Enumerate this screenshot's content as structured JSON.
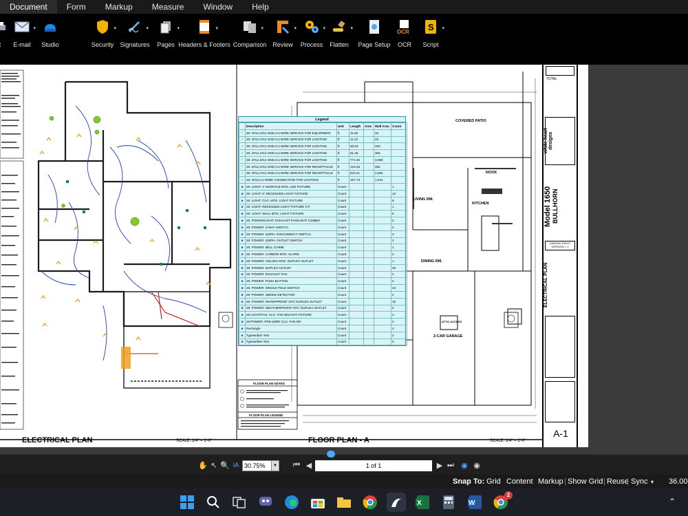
{
  "menu": [
    "Document",
    "Form",
    "Markup",
    "Measure",
    "Window",
    "Help"
  ],
  "ribbon": {
    "buttons": [
      {
        "label": "t",
        "icon": "print-icon"
      },
      {
        "label": "E-mail",
        "icon": "email-icon"
      },
      {
        "label": "Studio",
        "icon": "studio-icon"
      },
      {
        "label": "Security",
        "icon": "security-icon"
      },
      {
        "label": "Signatures",
        "icon": "signatures-icon"
      },
      {
        "label": "Pages",
        "icon": "pages-icon"
      },
      {
        "label": "Headers & Footers",
        "icon": "headers-footers-icon"
      },
      {
        "label": "Comparison",
        "icon": "comparison-icon"
      },
      {
        "label": "Review",
        "icon": "review-icon"
      },
      {
        "label": "Process",
        "icon": "process-icon"
      },
      {
        "label": "Flatten",
        "icon": "flatten-icon"
      },
      {
        "label": "Page Setup",
        "icon": "page-setup-icon"
      },
      {
        "label": "OCR",
        "icon": "ocr-icon"
      },
      {
        "label": "Script",
        "icon": "script-icon"
      }
    ]
  },
  "drawing": {
    "electrical_title": "ELECTRICAL PLAN",
    "floor_title": "FLOOR PLAN - A",
    "scale_text": "SCALE:  1/4\" = 1'-0\"",
    "floor_plan_notes_title": "FLOOR PLAN NOTES",
    "floor_plan_legend_title": "FLOOR PLAN LEGEND",
    "room_labels": [
      "COVERED PATIO",
      "LIVING RM.",
      "KITCHEN",
      "NOOK",
      "DINING RM.",
      "2-CAR GARAGE",
      "ATTIC ACCESS"
    ],
    "title_block": {
      "total": "TOTAL",
      "model": "Model 1650",
      "brand": "BULLHORN",
      "company": "white heart designs",
      "option": "GARAGE RIGHT VERSION = 1",
      "sheet_desc": "ELECTRICAL PLAN",
      "sheet_id": "A-1"
    }
  },
  "legend": {
    "title": "Legend",
    "headers": [
      "",
      "Description",
      "Unit",
      "Length",
      "Area",
      "Wall Area",
      "Count"
    ],
    "rows": [
      [
        "✓",
        "26: 2#12,1#12 GND.CU WIRE SERVICE FOR EQUIPMENT",
        "ft",
        "11.65",
        "",
        "46",
        ""
      ],
      [
        "✓",
        "26: 2#12,1#12 GND.CU WIRE SERVICE FOR LIGHTING",
        "ft",
        "11.22",
        "",
        "45",
        ""
      ],
      [
        "✓",
        "26: 2#12,1#12 GND.CU WIRE SERVICE FOR LIGHTING",
        "ft",
        "50.04",
        "",
        "200",
        ""
      ],
      [
        "✓",
        "26: 2#12,1#12 GND.CU WIRE SERVICE FOR LIGHTING",
        "ft",
        "91.26",
        "",
        "365",
        ""
      ],
      [
        "✓",
        "26: 2#12,1#12 GND.CU WIRE SERVICE FOR LIGHTING",
        "ft",
        "771.94",
        "",
        "3,088",
        ""
      ],
      [
        "✓",
        "26: 2#12,1#12 GND.CU WIRE SERVICE FOR RECEPTACLE",
        "ft",
        "120.53",
        "",
        "482",
        ""
      ],
      [
        "✓",
        "26: 2#12,1#12 GND.CU WIRE SERVICE FOR RECEPTACLE",
        "ft",
        "523.41",
        "",
        "2,094",
        ""
      ],
      [
        "✓",
        "26: 2#12,CU WIRE CONNECTION FOR LIGHTING",
        "ft",
        "257.73",
        "",
        "1,031",
        ""
      ],
      [
        "■",
        "26: LIGHT: 4' SURFACE MTD. LED FIXTURE",
        "Count",
        "",
        "",
        "",
        "1"
      ],
      [
        "■",
        "26: LIGHT: 6\" RECESSED LIGHT FIXTURE",
        "Count",
        "",
        "",
        "",
        "13"
      ],
      [
        "■",
        "26: LIGHT: CLG. MTD. LIGHT FIXTURE",
        "Count",
        "",
        "",
        "",
        "8"
      ],
      [
        "■",
        "26: LIGHT: RECESSED LIGHT FIXTURE V.P.",
        "Count",
        "",
        "",
        "",
        "1"
      ],
      [
        "■",
        "26: LIGHT: WALL MTD. LIGHT FIXTURE",
        "Count",
        "",
        "",
        "",
        "5"
      ],
      [
        "■",
        "26: POWER/LIGHT: EXHAUST FAN/LIGHT COMBO",
        "Count",
        "",
        "",
        "",
        "2"
      ],
      [
        "■",
        "26: POWER: 3-WAY SWITCH",
        "Count",
        "",
        "",
        "",
        "4"
      ],
      [
        "■",
        "26: POWER: 220PH. DISCONNECT SWITCH",
        "Count",
        "",
        "",
        "",
        "3"
      ],
      [
        "■",
        "26: POWER: 220PH. OUTLET SWITCH",
        "Count",
        "",
        "",
        "",
        "2"
      ],
      [
        "■",
        "26: POWER: BELL CHIME",
        "Count",
        "",
        "",
        "",
        "1"
      ],
      [
        "■",
        "26: POWER: CARBON MTD. ALARM",
        "Count",
        "",
        "",
        "",
        "2"
      ],
      [
        "■",
        "26: POWER: CEILING MTD. DUPLEX OUTLET",
        "Count",
        "",
        "",
        "",
        "1"
      ],
      [
        "■",
        "26: POWER: DUPLEX OUTLET",
        "Count",
        "",
        "",
        "",
        "20"
      ],
      [
        "■",
        "26: POWER: EXHAUST FAN",
        "Count",
        "",
        "",
        "",
        "2"
      ],
      [
        "■",
        "26: POWER: PUSH BUTTON",
        "Count",
        "",
        "",
        "",
        "2"
      ],
      [
        "■",
        "26: POWER: SINGLE POLE SWITCH",
        "Count",
        "",
        "",
        "",
        "24"
      ],
      [
        "■",
        "26: POWER: SMOKE DETECTOR",
        "Count",
        "",
        "",
        "",
        "2"
      ],
      [
        "■",
        "26: POWER: WATERPROOF GFC DUPLEX OUTLET",
        "Count",
        "",
        "",
        "",
        "16"
      ],
      [
        "■",
        "26: POWER: WEATHERPROOF GFC DUPLEX OUTLET",
        "Count",
        "",
        "",
        "",
        "2"
      ],
      [
        "■",
        "26 LIGHT/FAN: CLG. FAN W/LIGHT FIXTURE",
        "Count",
        "",
        "",
        "",
        "2"
      ],
      [
        "■",
        "26:POWER: PRE-WIRE CLG. FAN DR",
        "Count",
        "",
        "",
        "",
        "2"
      ],
      [
        "■",
        "Rectangle",
        "Count",
        "",
        "",
        "",
        "2"
      ],
      [
        "■",
        "Typewritten Text",
        "Count",
        "",
        "",
        "",
        "2"
      ],
      [
        "■",
        "Typewritten Text",
        "Count",
        "",
        "",
        "",
        "2"
      ]
    ]
  },
  "navbar": {
    "zoom": "30.75%",
    "page": "1 of 1"
  },
  "statusbar": {
    "snap_label": "Snap To:",
    "items": [
      "Grid",
      "Content",
      "Markup",
      "Show Grid",
      "Reuse",
      "Sync"
    ],
    "value": "36.00"
  },
  "taskbar": {
    "apps": [
      "windows-start-icon",
      "search-icon",
      "task-view-icon",
      "chat-icon",
      "edge-icon",
      "store-icon",
      "file-explorer-icon",
      "chrome-icon",
      "bluebeam-icon",
      "excel-icon",
      "calculator-icon",
      "word-icon",
      "chrome-icon"
    ],
    "badge": "2"
  },
  "colors": {
    "legend_bg": "#d7f4f7",
    "wire_blue": "#1c3fbf",
    "wire_red": "#c01818",
    "markup_orange": "#f0a020",
    "fixture_green": "#7ecb2a"
  }
}
